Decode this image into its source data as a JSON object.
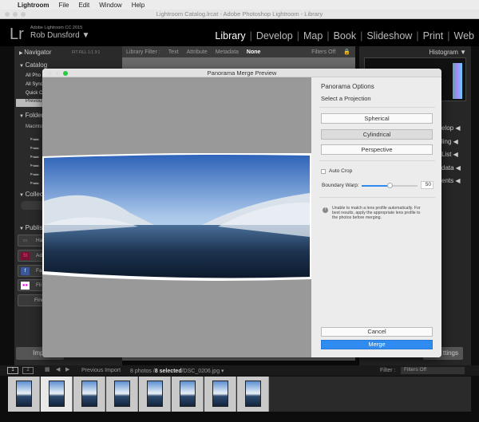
{
  "menubar": {
    "apple": "",
    "app": "Lightroom",
    "items": [
      "File",
      "Edit",
      "Window",
      "Help"
    ]
  },
  "window_title": "Lightroom Catalog.lrcat - Adobe Photoshop Lightroom - Library",
  "identity": {
    "logo": "Lr",
    "product": "Adobe Lightroom CC 2015",
    "user": "Rob Dunsford ▼"
  },
  "modules": [
    "Library",
    "Develop",
    "Map",
    "Book",
    "Slideshow",
    "Print",
    "Web"
  ],
  "left": {
    "navigator": "Navigator",
    "zoom": "FIT  FILL  1:1  3:1",
    "catalog": "Catalog",
    "catalog_items": [
      "All Pho",
      "All Sync",
      "Quick C",
      "Previous"
    ],
    "folders": "Folders",
    "volume": "Macintos",
    "collections": "Collections",
    "publish": "Publish",
    "publish_items": [
      "Ha",
      "Ad",
      "Fa",
      "Fli"
    ],
    "find": "Find",
    "import": "Impo"
  },
  "filterbar": {
    "label": "Library Filter :",
    "tabs": [
      "Text",
      "Attribute",
      "Metadata",
      "None"
    ],
    "status": "Filters Off"
  },
  "right": {
    "histogram": "Histogram ▼",
    "panels": [
      "elop",
      "ling",
      "List",
      "data",
      "ents"
    ],
    "settings": "ttings"
  },
  "dialog": {
    "title": "Panorama Merge Preview",
    "options_title": "Panorama Options",
    "projection_label": "Select a Projection",
    "projections": [
      "Spherical",
      "Cylindrical",
      "Perspective"
    ],
    "selected_projection": "Cylindrical",
    "auto_crop_label": "Auto Crop",
    "auto_crop": false,
    "boundary_warp_label": "Boundary Warp:",
    "boundary_warp": 50,
    "warning": "Unable to match a lens profile automatically. For best results, apply the appropriate lens profile to the photos before merging.",
    "cancel": "Cancel",
    "merge": "Merge"
  },
  "filmstrip": {
    "source": "Previous Import",
    "count": "8 photos /",
    "selected": "8 selected",
    "file": "/DSC_0206.jpg ▾",
    "filter_label": "Filter :",
    "filter_value": "Filters Off",
    "thumb_count": 8
  },
  "colors": {
    "accent": "#2f8bf0",
    "selected_bg": "#bbbbbb"
  }
}
